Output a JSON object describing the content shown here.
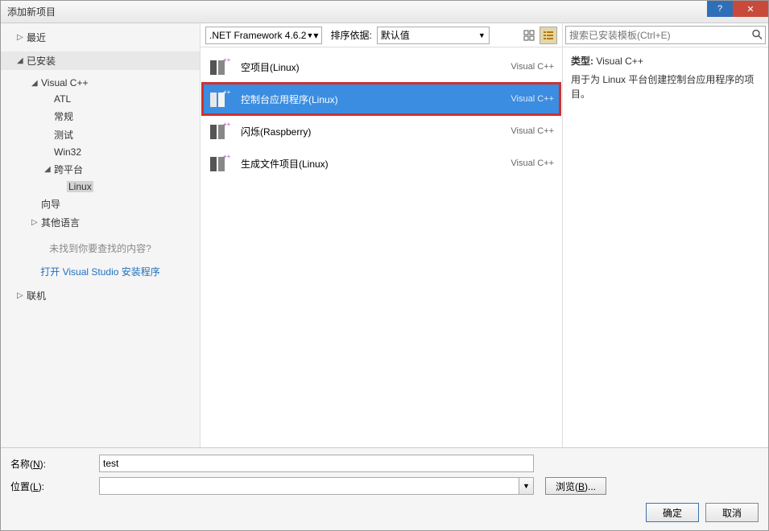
{
  "titlebar": {
    "title": "添加新项目"
  },
  "sidebar": {
    "recent": "最近",
    "installed": "已安装",
    "tree": {
      "vcpp": "Visual C++",
      "atl": "ATL",
      "general": "常规",
      "test": "测试",
      "win32": "Win32",
      "crossplatform": "跨平台",
      "linux": "Linux",
      "wizard": "向导",
      "otherlang": "其他语言"
    },
    "not_found": "未找到你要查找的内容?",
    "open_installer": "打开 Visual Studio 安装程序",
    "online": "联机"
  },
  "toolbar": {
    "framework": ".NET Framework 4.6.2",
    "sort_label": "排序依据:",
    "sort_value": "默认值"
  },
  "templates": [
    {
      "name": "空项目(Linux)",
      "lang": "Visual C++",
      "selected": false
    },
    {
      "name": "控制台应用程序(Linux)",
      "lang": "Visual C++",
      "selected": true
    },
    {
      "name": "闪烁(Raspberry)",
      "lang": "Visual C++",
      "selected": false
    },
    {
      "name": "生成文件项目(Linux)",
      "lang": "Visual C++",
      "selected": false
    }
  ],
  "right": {
    "search_placeholder": "搜索已安装模板(Ctrl+E)",
    "type_label": "类型:",
    "type_value": "Visual C++",
    "description": "用于为 Linux 平台创建控制台应用程序的项目。"
  },
  "bottom": {
    "name_label": "名称(N):",
    "name_value": "test",
    "location_label": "位置(L):",
    "location_value": " ",
    "browse": "浏览(B)...",
    "ok": "确定",
    "cancel": "取消"
  }
}
